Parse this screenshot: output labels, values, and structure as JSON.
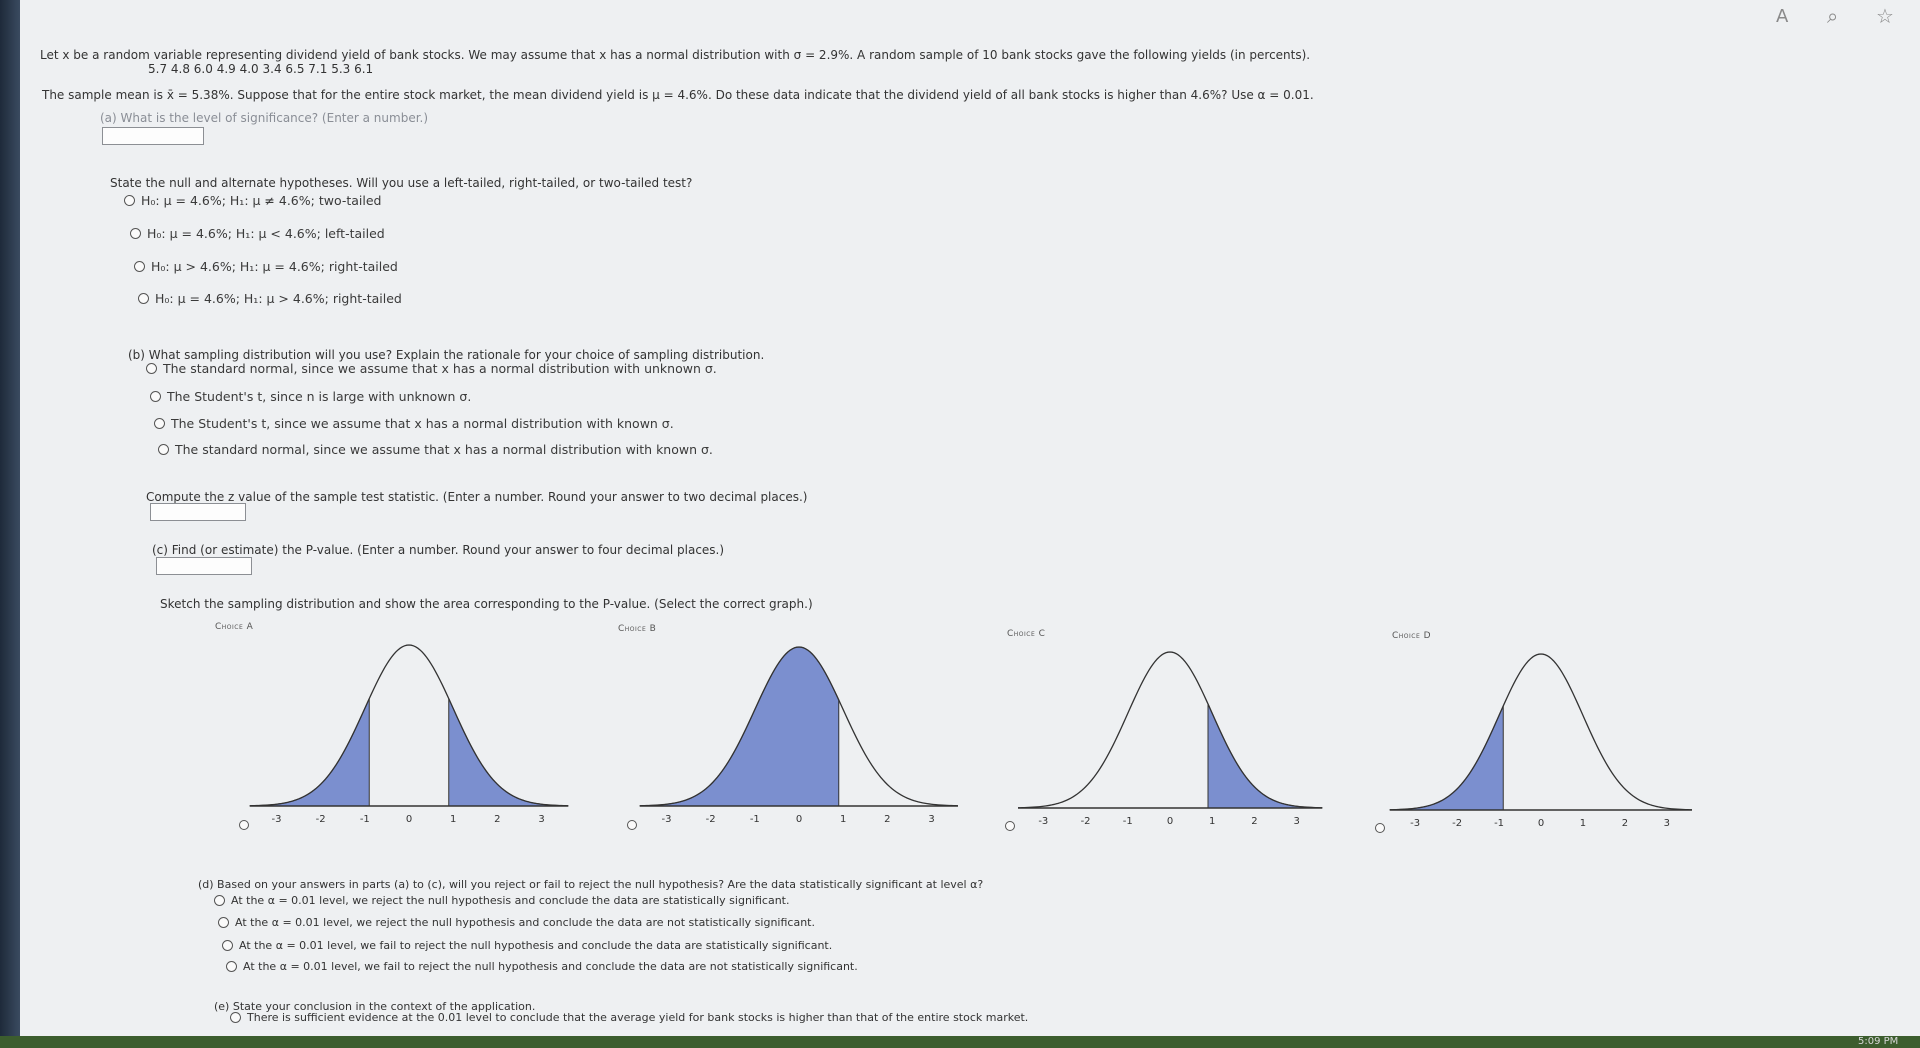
{
  "toolbar": {
    "read_aloud_icon": "A",
    "zoom_icon": "⌕",
    "favorite_icon": "☆"
  },
  "intro": {
    "line1": "Let x be a random variable representing dividend yield of bank stocks. We may assume that x has a normal distribution with σ = 2.9%. A random sample of 10 bank stocks gave the following yields (in percents).",
    "data_values": "5.7   4.8   6.0   4.9   4.0   3.4   6.5   7.1   5.3   6.1",
    "line2": "The sample mean is x̄ = 5.38%. Suppose that for the entire stock market, the mean dividend yield is μ = 4.6%. Do these data indicate that the dividend yield of all bank stocks is higher than 4.6%? Use α = 0.01."
  },
  "part_a": {
    "question": "(a) What is the level of significance? (Enter a number.)",
    "answer": "",
    "hyp_prompt": "State the null and alternate hypotheses. Will you use a left-tailed, right-tailed, or two-tailed test?",
    "options": [
      "H₀: μ = 4.6%; H₁: μ ≠ 4.6%; two-tailed",
      "H₀: μ = 4.6%; H₁: μ < 4.6%; left-tailed",
      "H₀: μ > 4.6%; H₁: μ = 4.6%; right-tailed",
      "H₀: μ = 4.6%; H₁: μ > 4.6%; right-tailed"
    ]
  },
  "part_b": {
    "question": "(b) What sampling distribution will you use? Explain the rationale for your choice of sampling distribution.",
    "options": [
      "The standard normal, since we assume that x has a normal distribution with unknown σ.",
      "The Student's t, since n is large with unknown σ.",
      "The Student's t, since we assume that x has a normal distribution with known σ.",
      "The standard normal, since we assume that x has a normal distribution with known σ."
    ],
    "z_prompt": "Compute the z value of the sample test statistic. (Enter a number. Round your answer to two decimal places.)",
    "z_answer": ""
  },
  "part_c": {
    "question": "(c) Find (or estimate) the P-value. (Enter a number. Round your answer to four decimal places.)",
    "p_answer": "",
    "sketch_prompt": "Sketch the sampling distribution and show the area corresponding to the P-value. (Select the correct graph.)",
    "graphs": [
      {
        "label": "Choice A",
        "shade": "two-tailed",
        "ticks": [
          "-3",
          "-2",
          "-1",
          "0",
          "1",
          "2",
          "3"
        ]
      },
      {
        "label": "Choice B",
        "shade": "left-to-1",
        "ticks": [
          "-3",
          "-2",
          "-1",
          "0",
          "1",
          "2",
          "3"
        ]
      },
      {
        "label": "Choice C",
        "shade": "right-from-1",
        "ticks": [
          "-3",
          "-2",
          "-1",
          "0",
          "1",
          "2",
          "3"
        ]
      },
      {
        "label": "Choice D",
        "shade": "left-from--1",
        "ticks": [
          "-3",
          "-2",
          "-1",
          "0",
          "1",
          "2",
          "3"
        ]
      }
    ],
    "shade_color": "#7b8fcf"
  },
  "part_d": {
    "question": "(d) Based on your answers in parts (a) to (c), will you reject or fail to reject the null hypothesis? Are the data statistically significant at level α?",
    "options": [
      "At the α = 0.01 level, we reject the null hypothesis and conclude the data are statistically significant.",
      "At the α = 0.01 level, we reject the null hypothesis and conclude the data are not statistically significant.",
      "At the α = 0.01 level, we fail to reject the null hypothesis and conclude the data are statistically significant.",
      "At the α = 0.01 level, we fail to reject the null hypothesis and conclude the data are not statistically significant."
    ]
  },
  "part_e": {
    "question": "(e) State your conclusion in the context of the application.",
    "options": [
      "There is sufficient evidence at the 0.01 level to conclude that the average yield for bank stocks is higher than that of the entire stock market."
    ]
  },
  "clock": "5:09 PM"
}
